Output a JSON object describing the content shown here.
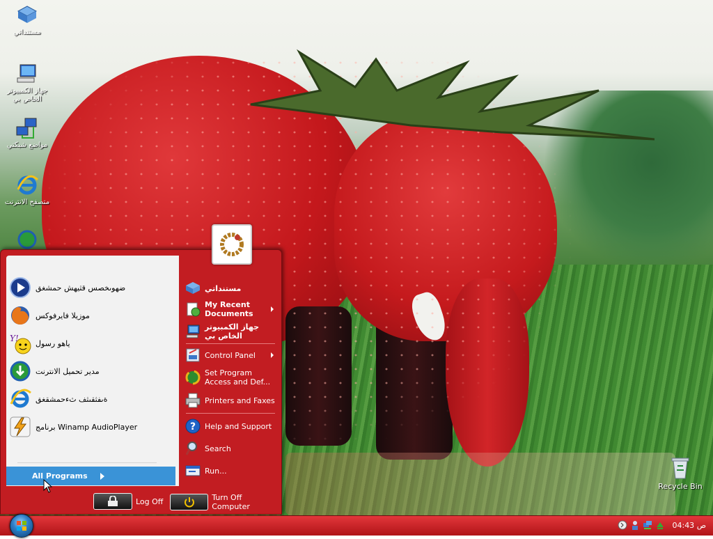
{
  "desktop": {
    "icons": [
      {
        "label": "مستنداتي",
        "icon": "documents-icon"
      },
      {
        "label": "جهاز الكمبيوتر الخاص بي",
        "icon": "my-computer-icon"
      },
      {
        "label": "مواضع شبكتي",
        "icon": "network-icon"
      },
      {
        "label": "متصفح الانترنت",
        "icon": "ie-icon"
      }
    ],
    "recycle_bin": "Recycle Bin"
  },
  "start_menu": {
    "pinned_programs": [
      {
        "label": "ضهوىخصس قثيهش حمشغق",
        "icon": "media-player-icon"
      },
      {
        "label": "موزيلا فايرفوكس",
        "icon": "firefox-icon"
      },
      {
        "label": "ياهو رسول",
        "icon": "yahoo-messenger-icon"
      },
      {
        "label": "مدير تحميل الانترنت",
        "icon": "internet-download-manager-icon"
      },
      {
        "label": "ةىفثقىثف ثءحمشقغق",
        "icon": "internet-explorer-icon"
      },
      {
        "label": "برنامج Winamp AudioPlayer",
        "icon": "winamp-icon"
      }
    ],
    "all_programs": "All Programs",
    "right": {
      "my_documents": "مستنداتي",
      "my_recent_documents": "My Recent Documents",
      "my_computer": "جهاز الكمبيوتر الخاص بي",
      "control_panel": "Control Panel",
      "set_program_access": "Set Program Access and Def...",
      "printers_faxes": "Printers and Faxes",
      "help_support": "Help and Support",
      "search": "Search",
      "run": "Run..."
    },
    "log_off": "Log Off",
    "turn_off": "Turn Off Computer"
  },
  "taskbar": {
    "clock": "04:43 ص"
  },
  "colors": {
    "menu_red": "#c21d22",
    "all_programs_blue": "#3a93d7",
    "taskbar_red": "#c8252a"
  }
}
